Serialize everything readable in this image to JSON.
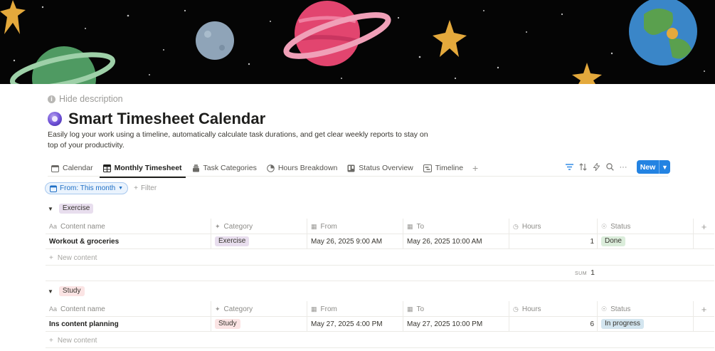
{
  "page": {
    "hide_description": "Hide description",
    "title": "Smart Timesheet Calendar",
    "description": "Easily log your work using a timeline, automatically calculate task durations, and get clear weekly reports to stay on top of your productivity."
  },
  "tabs": [
    {
      "label": "Calendar",
      "icon": "calendar-icon"
    },
    {
      "label": "Monthly Timesheet",
      "icon": "table-icon",
      "active": true
    },
    {
      "label": "Task Categories",
      "icon": "stack-icon"
    },
    {
      "label": "Hours Breakdown",
      "icon": "chart-icon"
    },
    {
      "label": "Status Overview",
      "icon": "board-icon"
    },
    {
      "label": "Timeline",
      "icon": "timeline-icon"
    }
  ],
  "toolbar": {
    "new_label": "New"
  },
  "filter": {
    "chip": "From: This month",
    "add": "Filter"
  },
  "columns": {
    "name": "Content name",
    "category": "Category",
    "from": "From",
    "to": "To",
    "hours": "Hours",
    "status": "Status",
    "name_prefix": "Aa"
  },
  "groups": [
    {
      "label": "Exercise",
      "color": "#e8deee",
      "rows": [
        {
          "name": "Workout & groceries",
          "category": "Exercise",
          "from": "May 26, 2025 9:00 AM",
          "to": "May 26, 2025 10:00 AM",
          "hours": "1",
          "status": "Done"
        }
      ],
      "new_label": "New content",
      "sum_label": "SUM",
      "sum_value": "1"
    },
    {
      "label": "Study",
      "color": "#fbe4e4",
      "rows": [
        {
          "name": "Ins content planning",
          "category": "Study",
          "from": "May 27, 2025 4:00 PM",
          "to": "May 27, 2025 10:00 PM",
          "hours": "6",
          "status": "In progress"
        }
      ],
      "new_label": "New content"
    }
  ],
  "colors": {
    "accent": "#2383e2",
    "done": "#dbeddb",
    "in_progress": "#d3e5ef"
  }
}
